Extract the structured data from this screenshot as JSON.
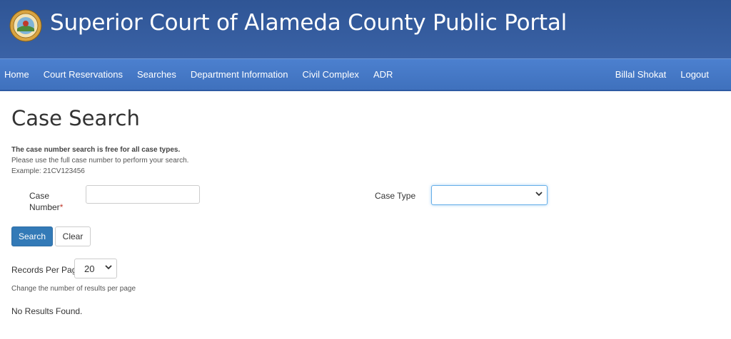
{
  "header": {
    "title": "Superior Court of Alameda County Public Portal",
    "seal_icon": "county-seal-icon"
  },
  "nav": {
    "items": [
      "Home",
      "Court Reservations",
      "Searches",
      "Department Information",
      "Civil Complex",
      "ADR"
    ],
    "user": "Billal Shokat",
    "logout": "Logout"
  },
  "page": {
    "title": "Case Search",
    "note_bold": "The case number search is free for all case types.",
    "note_1": "Please use the full case number to perform your search.",
    "note_2": "Example: 21CV123456"
  },
  "form": {
    "case_number_label": "Case Number",
    "required_mark": "*",
    "case_number_value": "",
    "case_type_label": "Case Type",
    "case_type_value": "",
    "search_button": "Search",
    "clear_button": "Clear",
    "records_per_page_label": "Records Per Page",
    "records_per_page_value": "20",
    "records_hint": "Change the number of results per page"
  },
  "results": {
    "message": "No Results Found."
  },
  "colors": {
    "header": "#3a62a6",
    "navbar": "#4678c6",
    "primary_button": "#337ab7",
    "required": "#c0392b"
  }
}
